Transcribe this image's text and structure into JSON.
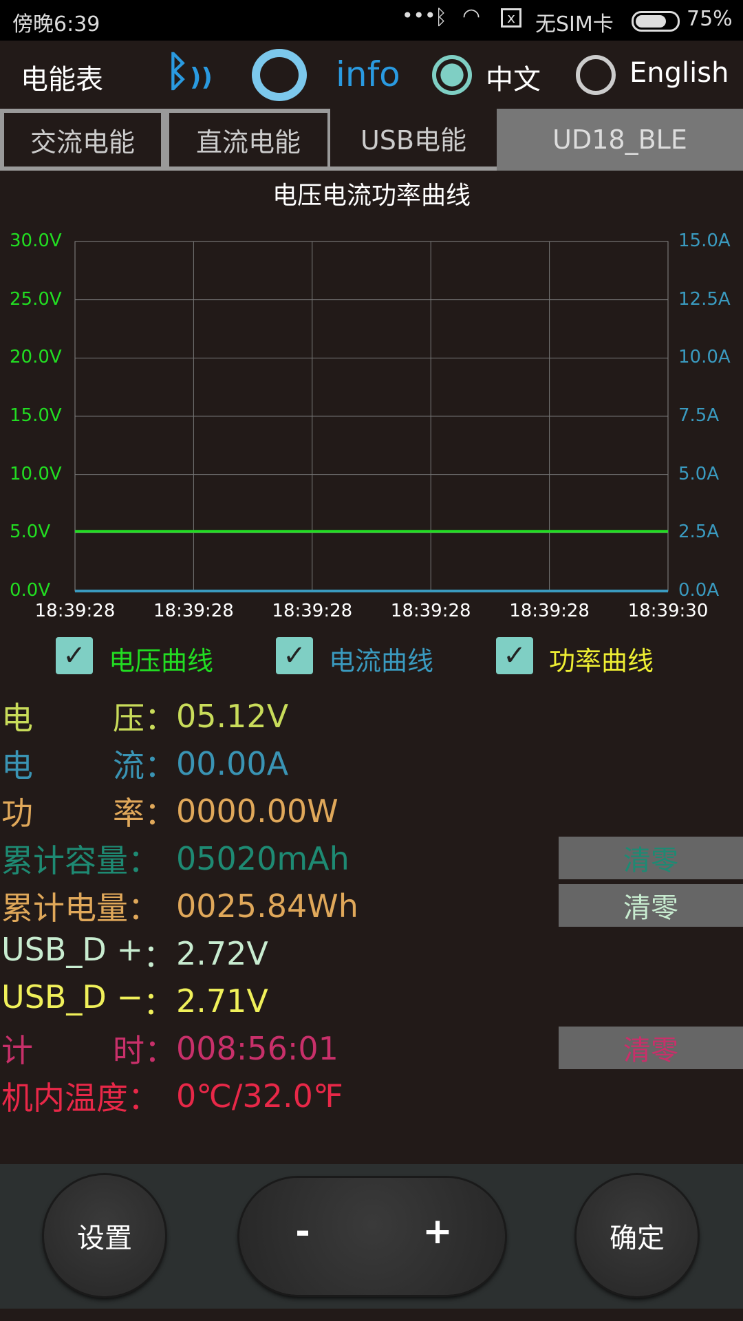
{
  "status_bar": {
    "time": "傍晚6:39",
    "sim": "无SIM卡",
    "battery": "75%",
    "battery_level": 0.75
  },
  "header": {
    "title": "电能表",
    "info": "info",
    "lang_zh": "中文",
    "lang_en": "English",
    "selected_lang": "中文"
  },
  "tabs": [
    {
      "label": "交流电能"
    },
    {
      "label": "直流电能"
    },
    {
      "label": "USB电能",
      "active": true
    },
    {
      "label": "UD18_BLE"
    }
  ],
  "chart_data": {
    "type": "line",
    "title": "电压电流功率曲线",
    "x": [
      "18:39:28",
      "18:39:28",
      "18:39:28",
      "18:39:28",
      "18:39:28",
      "18:39:30"
    ],
    "y_left_ticks": [
      "30.0V",
      "25.0V",
      "20.0V",
      "15.0V",
      "10.0V",
      "5.0V",
      "0.0V"
    ],
    "y_right_ticks": [
      "15.0A",
      "12.5A",
      "10.0A",
      "7.5A",
      "5.0A",
      "2.5A",
      "0.0A"
    ],
    "ylim_left": [
      0,
      30
    ],
    "ylim_right": [
      0,
      15
    ],
    "grid": true,
    "series": [
      {
        "name": "电压曲线",
        "color": "#22dd22",
        "values": [
          5.12,
          5.12,
          5.12,
          5.12,
          5.12,
          5.12
        ],
        "axis": "left"
      },
      {
        "name": "电流曲线",
        "color": "#3a9abf",
        "values": [
          0,
          0,
          0,
          0,
          0,
          0
        ],
        "axis": "right"
      },
      {
        "name": "功率曲线",
        "color": "#eeee33",
        "values": [
          0,
          0,
          0,
          0,
          0,
          0
        ],
        "axis": "left"
      }
    ]
  },
  "legend": [
    {
      "label": "电压曲线",
      "color": "#22dd22"
    },
    {
      "label": "电流曲线",
      "color": "#3a9abf"
    },
    {
      "label": "功率曲线",
      "color": "#eeee33"
    }
  ],
  "readings": [
    {
      "k1": "电",
      "k2": "压：",
      "value": "05.12V",
      "color": "#c9dc5a"
    },
    {
      "k1": "电",
      "k2": "流：",
      "value": "00.00A",
      "color": "#3a94b4"
    },
    {
      "k1": "功",
      "k2": "率：",
      "value": "0000.00W",
      "color": "#e0a85a"
    },
    {
      "k1": "累计容量",
      "k2": "：",
      "value": "05020mAh",
      "color": "#1e8a73"
    },
    {
      "k1": "累计电量",
      "k2": "：",
      "value": "0025.84Wh",
      "color": "#e0a85a"
    },
    {
      "k1": "USB_D +",
      "k2": "：",
      "value": "2.72V",
      "color": "#c8ecd0"
    },
    {
      "k1": "USB_D −",
      "k2": "：",
      "value": "2.71V",
      "color": "#f0f05a"
    },
    {
      "k1": "计",
      "k2": "时：",
      "value": "008:56:01",
      "color": "#c8306a"
    },
    {
      "k1": "机内温度",
      "k2": "：",
      "value": "0℃/32.0℉",
      "color": "#e82848"
    }
  ],
  "clear_label": "清零",
  "bottom": {
    "settings": "设置",
    "minus": "-",
    "plus": "+",
    "confirm": "确定"
  }
}
